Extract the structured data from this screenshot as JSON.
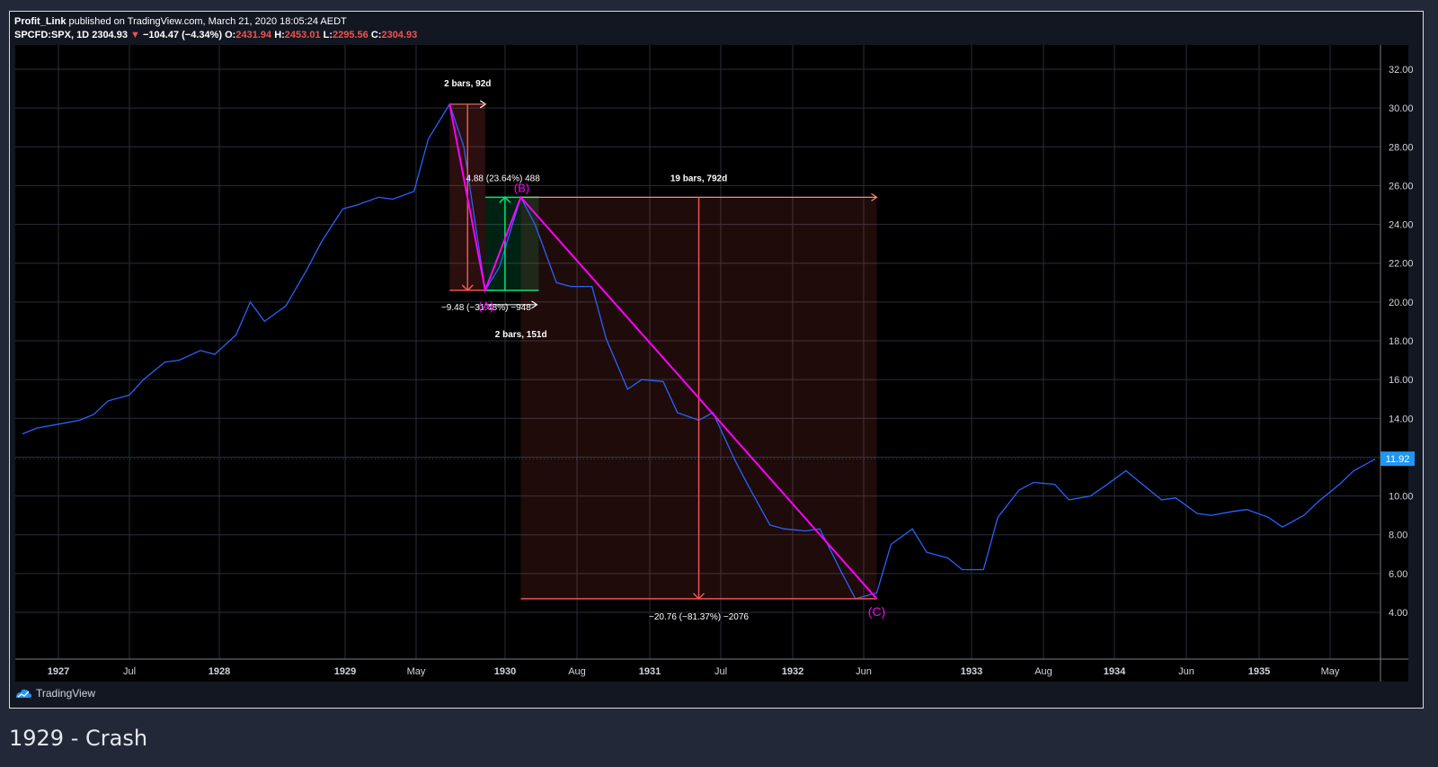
{
  "header": {
    "author": "Profit_Link",
    "published_text": "published on TradingView.com, March 21, 2020 18:05:24 AEDT",
    "symbol": "SPCFD:SPX, 1D",
    "last": "2304.93",
    "arrow": "▼",
    "change": "−104.47 (−4.34%)",
    "o_label": "O:",
    "o_value": "2431.94",
    "h_label": "H:",
    "h_value": "2453.01",
    "l_label": "L:",
    "l_value": "2295.56",
    "c_label": "C:",
    "c_value": "2304.93"
  },
  "brand": {
    "name": "TradingView",
    "icon": "tradingview-logo-icon"
  },
  "caption": "1929 - Crash",
  "colors": {
    "background": "#131722",
    "grid": "#2a2e39",
    "price_line": "#2962ff",
    "down": "#ef5350",
    "up": "#00e676",
    "wave": "#ff00ff",
    "last_price_badge": "#2196f3"
  },
  "chart_data": {
    "type": "line",
    "x_ticks": [
      "1927",
      "Jul",
      "1928",
      "1929",
      "May",
      "1930",
      "Aug",
      "1931",
      "Jul",
      "1932",
      "Jun",
      "1933",
      "Aug",
      "1934",
      "Jun",
      "1935",
      "May"
    ],
    "y_ticks": [
      "32.00",
      "30.00",
      "28.00",
      "26.00",
      "24.00",
      "22.00",
      "20.00",
      "18.00",
      "16.00",
      "14.00",
      "12.00",
      "10.00",
      "8.00",
      "6.00",
      "4.00"
    ],
    "ylim": [
      2,
      33
    ],
    "last_price": "11.92",
    "series": [
      {
        "values": [
          [
            1926.5,
            13.2
          ],
          [
            1926.6,
            13.5
          ],
          [
            1926.75,
            13.7
          ],
          [
            1926.9,
            13.9
          ],
          [
            1927.0,
            14.2
          ],
          [
            1927.1,
            14.9
          ],
          [
            1927.25,
            15.2
          ],
          [
            1927.35,
            16.0
          ],
          [
            1927.5,
            16.9
          ],
          [
            1927.6,
            17.0
          ],
          [
            1927.75,
            17.5
          ],
          [
            1927.85,
            17.3
          ],
          [
            1928.0,
            18.3
          ],
          [
            1928.1,
            20.0
          ],
          [
            1928.2,
            19.0
          ],
          [
            1928.35,
            19.8
          ],
          [
            1928.5,
            21.7
          ],
          [
            1928.6,
            23.1
          ],
          [
            1928.75,
            24.8
          ],
          [
            1928.85,
            25.0
          ],
          [
            1929.0,
            25.4
          ],
          [
            1929.1,
            25.3
          ],
          [
            1929.25,
            25.7
          ],
          [
            1929.35,
            28.4
          ],
          [
            1929.5,
            30.2
          ],
          [
            1929.6,
            28.0
          ],
          [
            1929.75,
            20.6
          ],
          [
            1929.85,
            21.8
          ],
          [
            1930.0,
            25.4
          ],
          [
            1930.1,
            24.0
          ],
          [
            1930.25,
            21.0
          ],
          [
            1930.35,
            20.8
          ],
          [
            1930.5,
            20.8
          ],
          [
            1930.6,
            18.1
          ],
          [
            1930.75,
            15.5
          ],
          [
            1930.85,
            16.0
          ],
          [
            1931.0,
            15.9
          ],
          [
            1931.1,
            14.3
          ],
          [
            1931.25,
            13.9
          ],
          [
            1931.35,
            14.3
          ],
          [
            1931.5,
            11.9
          ],
          [
            1931.6,
            10.5
          ],
          [
            1931.75,
            8.5
          ],
          [
            1931.85,
            8.3
          ],
          [
            1932.0,
            8.2
          ],
          [
            1932.1,
            8.3
          ],
          [
            1932.25,
            6.1
          ],
          [
            1932.35,
            4.7
          ],
          [
            1932.5,
            5.0
          ],
          [
            1932.6,
            7.5
          ],
          [
            1932.75,
            8.3
          ],
          [
            1932.85,
            7.1
          ],
          [
            1933.0,
            6.8
          ],
          [
            1933.1,
            6.2
          ],
          [
            1933.25,
            6.2
          ],
          [
            1933.35,
            8.9
          ],
          [
            1933.5,
            10.3
          ],
          [
            1933.6,
            10.7
          ],
          [
            1933.75,
            10.6
          ],
          [
            1933.85,
            9.8
          ],
          [
            1934.0,
            10.0
          ],
          [
            1934.1,
            10.5
          ],
          [
            1934.25,
            11.3
          ],
          [
            1934.35,
            10.7
          ],
          [
            1934.5,
            9.8
          ],
          [
            1934.6,
            9.9
          ],
          [
            1934.75,
            9.1
          ],
          [
            1934.85,
            9.0
          ],
          [
            1935.0,
            9.2
          ],
          [
            1935.1,
            9.3
          ],
          [
            1935.25,
            8.9
          ],
          [
            1935.35,
            8.4
          ],
          [
            1935.5,
            9.0
          ],
          [
            1935.6,
            9.7
          ],
          [
            1935.75,
            10.6
          ],
          [
            1935.85,
            11.3
          ],
          [
            1936.0,
            11.9
          ]
        ]
      }
    ],
    "annotations": [
      {
        "label": "2 bars, 92d"
      },
      {
        "label": "4.88 (23.64%) 488"
      },
      {
        "label": "−9.48 (−31.48%) −948"
      },
      {
        "label": "2 bars, 151d"
      },
      {
        "label": "19 bars, 792d"
      },
      {
        "label": "−20.76 (−81.37%) −2076"
      },
      {
        "label": "(A)"
      },
      {
        "label": "(B)"
      },
      {
        "label": "(C)"
      }
    ],
    "wave_points": [
      {
        "name": "start",
        "x": 1929.5,
        "y": 30.2
      },
      {
        "name": "A",
        "x": 1929.75,
        "y": 20.6
      },
      {
        "name": "B",
        "x": 1930.0,
        "y": 25.4
      },
      {
        "name": "C",
        "x": 1932.5,
        "y": 4.7
      }
    ]
  }
}
